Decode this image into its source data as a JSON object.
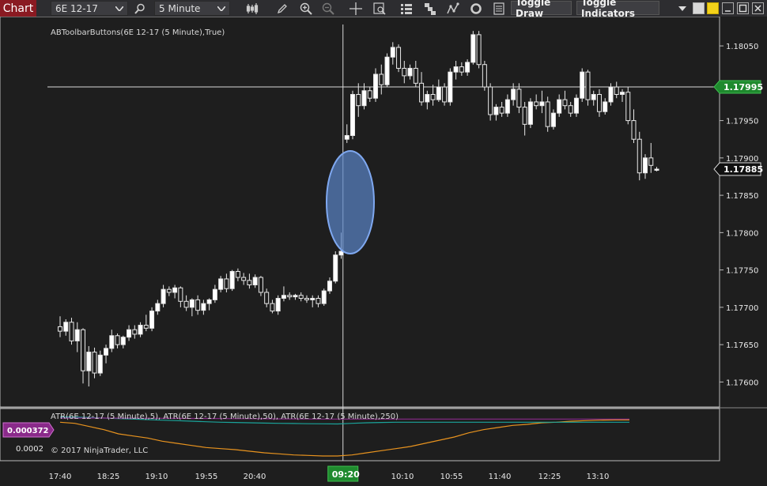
{
  "toolbar": {
    "chart_tab": "Chart",
    "instrument": "6E 12-17",
    "interval": "5 Minute",
    "toggle_draw": "Toggle Draw",
    "toggle_indicators": "Toggle Indicators",
    "icons": [
      "search-icon",
      "bar-chart-icon",
      "pencil-icon",
      "zoom-in-icon",
      "zoom-out-icon",
      "crosshair-icon",
      "data-box-icon",
      "strategy-icon",
      "hierarchy-icon",
      "line-chart-icon",
      "refresh-icon",
      "properties-icon"
    ]
  },
  "colors": {
    "background": "#1e1e1e",
    "grid_line": "#c8c8c8",
    "candle_up": "#ffffff",
    "candle_down": "#ffffff",
    "atr_5": "#e8931e",
    "atr_50": "#1aa39a",
    "atr_250": "#8a2a8a",
    "crosshair_price_badge": "#1f8a2e",
    "last_price_badge": "#111111",
    "ellipse_fill": "#6f9ee8",
    "atr_badge": "#8a2a8a"
  },
  "chart": {
    "title": "ABToolbarButtons(6E 12-17 (5 Minute),True)",
    "price_ticks": [
      "1.18050",
      "1.18000",
      "1.17950",
      "1.17900",
      "1.17850",
      "1.17800",
      "1.17750",
      "1.17700",
      "1.17650",
      "1.17600"
    ],
    "crosshair_price": "1.17995",
    "last_price": "1.17885",
    "time_labels": [
      "17:40",
      "18:25",
      "19:10",
      "19:55",
      "20:40",
      "09:20",
      "10:10",
      "10:55",
      "11:40",
      "12:25",
      "13:10"
    ],
    "crosshair_time": "09:20"
  },
  "indicator": {
    "title": "ATR(6E 12-17 (5 Minute),5), ATR(6E 12-17 (5 Minute),50), ATR(6E 12-17 (5 Minute),250)",
    "current_value": "0.000372",
    "axis_tick": "0.0002",
    "copyright": "© 2017 NinjaTrader, LLC"
  },
  "chart_data": {
    "type": "candlestick",
    "title": "ABToolbarButtons(6E 12-17 (5 Minute),True)",
    "ylim": [
      1.17575,
      1.18085
    ],
    "x_labels": [
      "17:40",
      "18:25",
      "19:10",
      "19:55",
      "20:40",
      "09:20",
      "10:10",
      "10:55",
      "11:40",
      "12:25",
      "13:10"
    ],
    "bars": [
      [
        1.17674,
        1.17688,
        1.1766,
        1.17668
      ],
      [
        1.17668,
        1.17684,
        1.17662,
        1.1768
      ],
      [
        1.1768,
        1.17686,
        1.1765,
        1.17655
      ],
      [
        1.17655,
        1.1768,
        1.1764,
        1.1767
      ],
      [
        1.1767,
        1.17672,
        1.17598,
        1.17615
      ],
      [
        1.17615,
        1.17648,
        1.17594,
        1.1764
      ],
      [
        1.1764,
        1.17646,
        1.17605,
        1.17612
      ],
      [
        1.17612,
        1.17642,
        1.17608,
        1.17636
      ],
      [
        1.17636,
        1.1765,
        1.17625,
        1.17645
      ],
      [
        1.17645,
        1.1767,
        1.1764,
        1.17662
      ],
      [
        1.17662,
        1.17665,
        1.17645,
        1.1765
      ],
      [
        1.1765,
        1.17662,
        1.17645,
        1.1766
      ],
      [
        1.1766,
        1.17676,
        1.17655,
        1.1767
      ],
      [
        1.1767,
        1.17676,
        1.17658,
        1.17664
      ],
      [
        1.17664,
        1.1768,
        1.1766,
        1.17676
      ],
      [
        1.17676,
        1.1769,
        1.17668,
        1.17672
      ],
      [
        1.17672,
        1.177,
        1.17668,
        1.17695
      ],
      [
        1.17695,
        1.1771,
        1.1769,
        1.17705
      ],
      [
        1.17705,
        1.1773,
        1.177,
        1.17724
      ],
      [
        1.17724,
        1.17728,
        1.17715,
        1.1772
      ],
      [
        1.1772,
        1.1773,
        1.17712,
        1.17726
      ],
      [
        1.17726,
        1.17728,
        1.177,
        1.17708
      ],
      [
        1.17708,
        1.17716,
        1.17695,
        1.177
      ],
      [
        1.177,
        1.17712,
        1.17688,
        1.1771
      ],
      [
        1.1771,
        1.17716,
        1.1769,
        1.17696
      ],
      [
        1.17696,
        1.1771,
        1.1769,
        1.17705
      ],
      [
        1.17705,
        1.17712,
        1.17696,
        1.1771
      ],
      [
        1.1771,
        1.1773,
        1.17706,
        1.17724
      ],
      [
        1.17724,
        1.17742,
        1.1772,
        1.17738
      ],
      [
        1.17738,
        1.17745,
        1.1772,
        1.17725
      ],
      [
        1.17725,
        1.1775,
        1.17722,
        1.17748
      ],
      [
        1.17748,
        1.17752,
        1.17735,
        1.1774
      ],
      [
        1.1774,
        1.17746,
        1.1773,
        1.17736
      ],
      [
        1.17736,
        1.17745,
        1.17725,
        1.1773
      ],
      [
        1.1773,
        1.17744,
        1.17726,
        1.1774
      ],
      [
        1.1774,
        1.17742,
        1.17715,
        1.1772
      ],
      [
        1.1772,
        1.17725,
        1.177,
        1.17705
      ],
      [
        1.17705,
        1.1771,
        1.17692,
        1.17695
      ],
      [
        1.17695,
        1.17716,
        1.1769,
        1.17712
      ],
      [
        1.17712,
        1.17728,
        1.17708,
        1.17716
      ],
      [
        1.17716,
        1.1772,
        1.1771,
        1.17714
      ],
      [
        1.17714,
        1.17718,
        1.1771,
        1.17716
      ],
      [
        1.17716,
        1.1772,
        1.17708,
        1.17712
      ],
      [
        1.17712,
        1.17716,
        1.17706,
        1.1771
      ],
      [
        1.1771,
        1.17716,
        1.177,
        1.17712
      ],
      [
        1.17712,
        1.17716,
        1.177,
        1.17705
      ],
      [
        1.17705,
        1.17725,
        1.17702,
        1.17722
      ],
      [
        1.17722,
        1.1774,
        1.17718,
        1.17735
      ],
      [
        1.17735,
        1.17775,
        1.17732,
        1.1777
      ],
      [
        1.1777,
        1.178,
        1.17765,
        1.17775
      ],
      [
        1.17925,
        1.17945,
        1.1792,
        1.1793
      ],
      [
        1.1793,
        1.1799,
        1.17925,
        1.17985
      ],
      [
        1.17985,
        1.18,
        1.17955,
        1.1797
      ],
      [
        1.1797,
        1.18,
        1.17965,
        1.1799
      ],
      [
        1.1799,
        1.17995,
        1.17975,
        1.1798
      ],
      [
        1.1798,
        1.1802,
        1.17975,
        1.18012
      ],
      [
        1.18012,
        1.18025,
        1.17985,
        1.17998
      ],
      [
        1.17998,
        1.1804,
        1.17995,
        1.18035
      ],
      [
        1.18035,
        1.18055,
        1.18025,
        1.18048
      ],
      [
        1.18048,
        1.18052,
        1.18015,
        1.1802
      ],
      [
        1.1802,
        1.1803,
        1.18,
        1.1801
      ],
      [
        1.1801,
        1.18025,
        1.18005,
        1.1802
      ],
      [
        1.1802,
        1.1803,
        1.17995,
        1.18
      ],
      [
        1.18,
        1.18015,
        1.1797,
        1.17975
      ],
      [
        1.17975,
        1.1799,
        1.17965,
        1.17985
      ],
      [
        1.17985,
        1.17998,
        1.1797,
        1.17978
      ],
      [
        1.17978,
        1.18005,
        1.17975,
        1.17995
      ],
      [
        1.17995,
        1.18,
        1.1797,
        1.17975
      ],
      [
        1.17975,
        1.1802,
        1.1797,
        1.18015
      ],
      [
        1.18015,
        1.1803,
        1.18005,
        1.18022
      ],
      [
        1.18022,
        1.18028,
        1.1801,
        1.18015
      ],
      [
        1.18015,
        1.18032,
        1.1801,
        1.18028
      ],
      [
        1.18028,
        1.1807,
        1.18025,
        1.18065
      ],
      [
        1.18065,
        1.1807,
        1.1802,
        1.18025
      ],
      [
        1.18025,
        1.1803,
        1.1799,
        1.17995
      ],
      [
        1.17995,
        1.18,
        1.1795,
        1.17958
      ],
      [
        1.17958,
        1.17972,
        1.1795,
        1.17968
      ],
      [
        1.17968,
        1.17975,
        1.17955,
        1.1796
      ],
      [
        1.1796,
        1.17985,
        1.17955,
        1.17978
      ],
      [
        1.17978,
        1.18,
        1.1797,
        1.17992
      ],
      [
        1.17992,
        1.18,
        1.1796,
        1.17968
      ],
      [
        1.17968,
        1.17975,
        1.1793,
        1.17945
      ],
      [
        1.17945,
        1.1798,
        1.1794,
        1.17975
      ],
      [
        1.17975,
        1.17985,
        1.17965,
        1.1797
      ],
      [
        1.1797,
        1.1799,
        1.1796,
        1.17975
      ],
      [
        1.17975,
        1.17982,
        1.17935,
        1.17942
      ],
      [
        1.17942,
        1.17965,
        1.17938,
        1.1796
      ],
      [
        1.1796,
        1.17985,
        1.17955,
        1.17978
      ],
      [
        1.17978,
        1.1799,
        1.17965,
        1.1797
      ],
      [
        1.1797,
        1.17975,
        1.17955,
        1.1796
      ],
      [
        1.1796,
        1.17985,
        1.17955,
        1.1798
      ],
      [
        1.1798,
        1.1802,
        1.17975,
        1.18015
      ],
      [
        1.18015,
        1.18018,
        1.1797,
        1.17978
      ],
      [
        1.17978,
        1.1799,
        1.1797,
        1.17985
      ],
      [
        1.17985,
        1.17992,
        1.17955,
        1.17962
      ],
      [
        1.17962,
        1.1798,
        1.17958,
        1.17975
      ],
      [
        1.17975,
        1.18,
        1.1797,
        1.17995
      ],
      [
        1.17995,
        1.18002,
        1.1798,
        1.17985
      ],
      [
        1.17985,
        1.17992,
        1.17975,
        1.17988
      ],
      [
        1.17988,
        1.17995,
        1.17945,
        1.1795
      ],
      [
        1.1795,
        1.17965,
        1.1792,
        1.17925
      ],
      [
        1.17925,
        1.17935,
        1.1787,
        1.1788
      ],
      [
        1.1788,
        1.17905,
        1.17872,
        1.179
      ],
      [
        1.179,
        1.1792,
        1.1788,
        1.1789
      ],
      [
        1.17885,
        1.17888,
        1.17882,
        1.17885
      ]
    ],
    "atr": {
      "series": [
        {
          "name": "ATR(6E 12-17 (5 Minute),5)",
          "values": [
            0.00035,
            0.00034,
            0.00031,
            0.00028,
            0.00024,
            0.00022,
            0.0002,
            0.00017,
            0.00015,
            0.00013,
            0.00011,
            0.0001,
            9e-05,
            7.5e-05,
            6e-05,
            5e-05,
            4e-05,
            3.5e-05,
            3e-05,
            3e-05,
            4e-05,
            6e-05,
            8e-05,
            0.0001,
            0.00012,
            0.00015,
            0.00018,
            0.00021,
            0.00025,
            0.00028,
            0.0003,
            0.00032,
            0.00033,
            0.000345,
            0.00035,
            0.00036,
            0.000365,
            0.00037,
            0.000372,
            0.000372
          ]
        },
        {
          "name": "ATR(6E 12-17 (5 Minute),50)",
          "values": [
            0.0004,
            0.000398,
            0.000395,
            0.00039,
            0.000385,
            0.00038,
            0.000375,
            0.00037,
            0.000365,
            0.00036,
            0.000355,
            0.00035,
            0.000348,
            0.000345,
            0.000342,
            0.00034,
            0.000338,
            0.000336,
            0.000335,
            0.000334,
            0.00034,
            0.000345,
            0.000348,
            0.00035,
            0.00035,
            0.00035,
            0.00035,
            0.00035,
            0.00035,
            0.00035,
            0.00035,
            0.00035,
            0.00035,
            0.00035,
            0.00035,
            0.00035,
            0.00035,
            0.00035,
            0.00035,
            0.00035
          ]
        },
        {
          "name": "ATR(6E 12-17 (5 Minute),250)",
          "values": [
            0.00039,
            0.00039,
            0.00039,
            0.00039,
            0.000389,
            0.000389,
            0.000388,
            0.000388,
            0.000387,
            0.000386,
            0.000386,
            0.000385,
            0.000384,
            0.000384,
            0.000383,
            0.000382,
            0.000382,
            0.000381,
            0.00038,
            0.00038,
            0.00038,
            0.00038,
            0.00038,
            0.00038,
            0.00038,
            0.00038,
            0.00038,
            0.00038,
            0.00038,
            0.00038,
            0.00038,
            0.00038,
            0.00038,
            0.00038,
            0.00038,
            0.00038,
            0.00038,
            0.00038,
            0.00038,
            0.00038
          ]
        }
      ]
    }
  }
}
